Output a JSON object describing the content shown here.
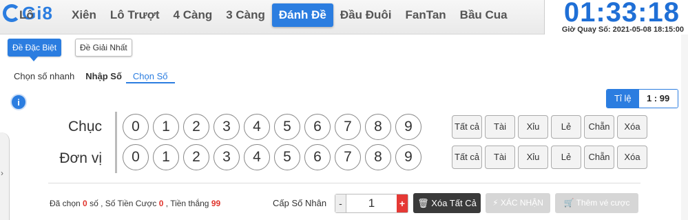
{
  "logo": {
    "text": "Gi8",
    "overlap": "Lô"
  },
  "nav": {
    "items": [
      {
        "label": "Xiên"
      },
      {
        "label": "Lô Trượt"
      },
      {
        "label": "4 Càng"
      },
      {
        "label": "3 Càng"
      },
      {
        "label": "Đánh Đề",
        "active": true
      },
      {
        "label": "Đầu Đuôi"
      },
      {
        "label": "FanTan"
      },
      {
        "label": "Bầu Cua"
      }
    ]
  },
  "clock": {
    "time": "01:33:18",
    "draw_label": "Giờ Quay Số: 2021-05-08 18:15:00"
  },
  "subtabs": {
    "special": "Đề Đặc Biệt",
    "first": "Đề Giải Nhất"
  },
  "modes": {
    "quick": "Chọn số nhanh",
    "manual": "Nhập Số",
    "pick": "Chọn Số"
  },
  "info_icon": "i",
  "ratio": {
    "label": "Tỉ lệ",
    "value": "1 : 99"
  },
  "rows": {
    "tens": {
      "label": "Chục"
    },
    "units": {
      "label": "Đơn vị"
    }
  },
  "digits": [
    "0",
    "1",
    "2",
    "3",
    "4",
    "5",
    "6",
    "7",
    "8",
    "9"
  ],
  "quick_buttons": {
    "all": "Tất cả",
    "big": "Tài",
    "small": "Xỉu",
    "odd": "Lẻ",
    "even": "Chẵn",
    "clear": "Xóa"
  },
  "summary": {
    "selected_label": "Đã chọn",
    "selected_count": "0",
    "selected_unit": "số ,",
    "bet_label": "Số Tiền Cược",
    "bet_value": "0",
    "win_label": ", Tiền thắng",
    "win_value": "99"
  },
  "multiplier": {
    "label": "Cấp Số Nhân",
    "minus": "-",
    "value": "1",
    "plus": "+"
  },
  "actions": {
    "clear_all": "Xóa Tất Cả",
    "confirm": "XÁC NHẬN",
    "add_bet": "Thêm vé cược"
  },
  "colors": {
    "accent": "#2b7de0",
    "danger": "#e53935",
    "highlight": "#e0342c"
  }
}
